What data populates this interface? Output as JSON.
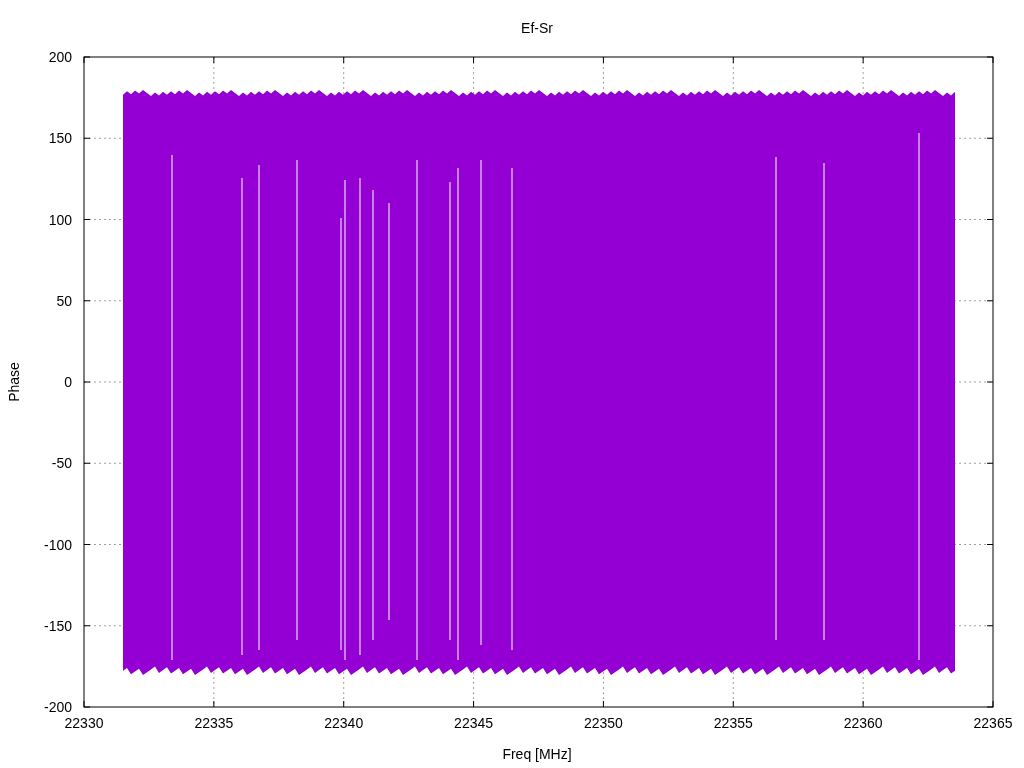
{
  "plot": {
    "title": "Ef-Sr",
    "xlabel": "Freq [MHz]",
    "ylabel": "Phase",
    "xticks": [
      "22330",
      "22335",
      "22340",
      "22345",
      "22350",
      "22355",
      "22360",
      "22365"
    ],
    "yticks": [
      "200",
      "150",
      "100",
      "50",
      "0",
      "-50",
      "-100",
      "-150",
      "-200"
    ]
  }
}
